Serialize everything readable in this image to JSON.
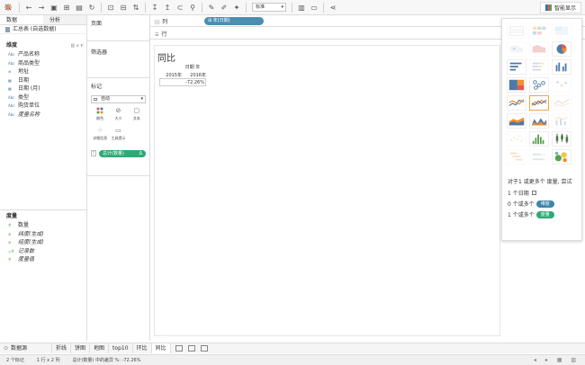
{
  "toolbar": {
    "view_size": "标准",
    "show_me_label": "智能显示",
    "icons": [
      "tableau-logo-icon",
      "undo-icon",
      "redo-icon",
      "save-icon",
      "new-datasource-icon",
      "pause-icon",
      "new-sheet-icon",
      "duplicate-icon",
      "clear-icon",
      "swap-icon",
      "sort-asc-icon",
      "sort-desc-icon",
      "highlight-icon",
      "group-icon",
      "label-icon",
      "fix-axes-icon",
      "presentation-icon",
      "share-icon"
    ]
  },
  "data_pane": {
    "tabs": [
      "数据",
      "分析"
    ],
    "datasource": "汇总表 (自选数据)",
    "dimensions_header": "维度",
    "dimensions": [
      {
        "type": "Abc",
        "name": "产品名称",
        "italic": false
      },
      {
        "type": "Abc",
        "name": "商品类型",
        "italic": false
      },
      {
        "type": "⊕",
        "name": "地址",
        "italic": false
      },
      {
        "type": "▦",
        "name": "日期",
        "italic": false
      },
      {
        "type": "▦",
        "name": "日期 (月)",
        "italic": false
      },
      {
        "type": "Abc",
        "name": "类型",
        "italic": false
      },
      {
        "type": "Abc",
        "name": "购货单位",
        "italic": false
      },
      {
        "type": "Abc",
        "name": "度量名称",
        "italic": true
      }
    ],
    "measures_header": "度量",
    "measures": [
      {
        "type": "#",
        "name": "数量",
        "italic": false
      },
      {
        "type": "⊕",
        "name": "纬度(生成)",
        "italic": true
      },
      {
        "type": "⊕",
        "name": "经度(生成)",
        "italic": true
      },
      {
        "type": "=#",
        "name": "记录数",
        "italic": true
      },
      {
        "type": "#",
        "name": "度量值",
        "italic": true
      }
    ]
  },
  "cards": {
    "pages": "页面",
    "filters": "筛选器",
    "marks": "标记",
    "mark_type": "自动",
    "mark_buttons": [
      "颜色",
      "大小",
      "文本",
      "详细信息",
      "工具提示"
    ],
    "pill": "总计(数量)",
    "pill_flag": "Δ"
  },
  "shelves": {
    "columns_label": "列",
    "columns_pill": "年(日期)",
    "rows_label": "行"
  },
  "view": {
    "title": "同比",
    "header_top": "日期 年",
    "years": [
      "2015年",
      "2016年"
    ],
    "values": [
      "",
      "-72.26%"
    ]
  },
  "show_me": {
    "hint": "对于1 或更多个 度量, 尝试",
    "req1": "1 个日期",
    "req2_prefix": "0 个或多个",
    "req2_chip": "维度",
    "req3_prefix": "1 个或多个",
    "req3_chip": "度量"
  },
  "bottom": {
    "datasource_tab": "数据源",
    "tabs": [
      "折线",
      "饼图",
      "地图",
      "top10",
      "环比",
      "同比"
    ],
    "active_tab": "同比"
  },
  "status": {
    "marks": "2 个标记",
    "rows_cols": "1 行 x 2 列",
    "sum": "总计(数量) 中的差异 %: -72.26%"
  },
  "colors": {
    "dimension_pill": "#4a8fb0",
    "measure_pill": "#2ea977",
    "selected_chart": "#e8a845"
  }
}
